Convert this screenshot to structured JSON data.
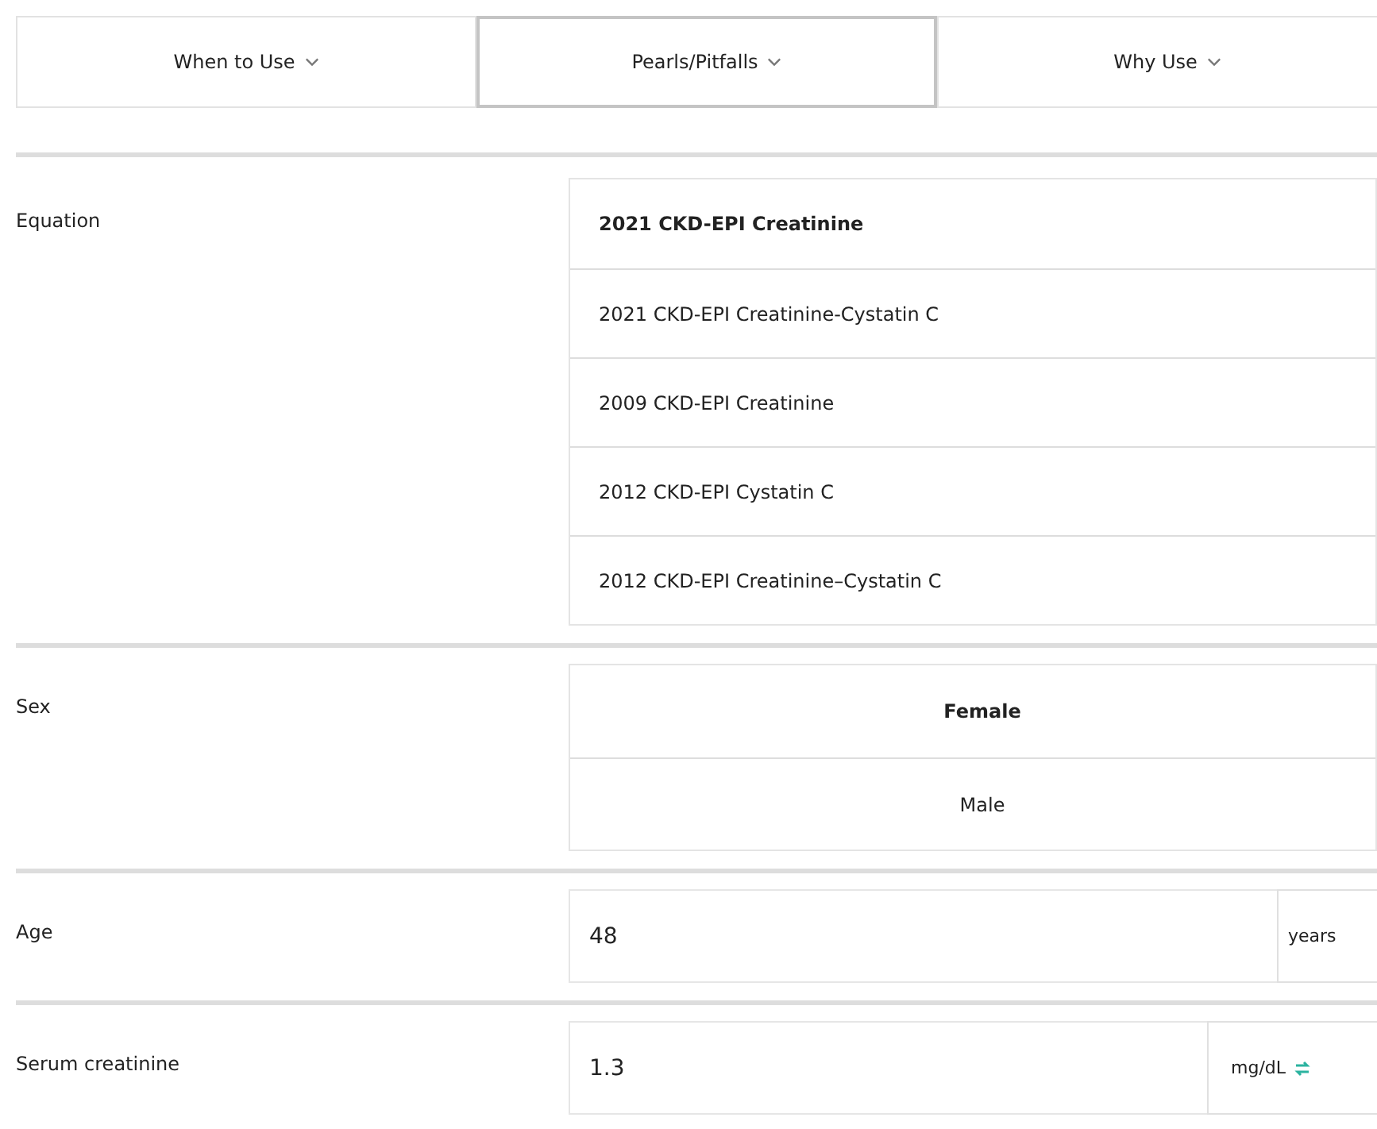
{
  "tabs": [
    {
      "label": "When to Use",
      "selected": false
    },
    {
      "label": "Pearls/Pitfalls",
      "selected": true
    },
    {
      "label": "Why Use",
      "selected": false
    }
  ],
  "fields": [
    {
      "kind": "list",
      "label": "Equation",
      "options": [
        {
          "label": "2021 CKD-EPI Creatinine",
          "selected": true
        },
        {
          "label": "2021 CKD-EPI Creatinine-Cystatin C",
          "selected": false
        },
        {
          "label": "2009 CKD-EPI Creatinine",
          "selected": false
        },
        {
          "label": "2012 CKD-EPI Cystatin C",
          "selected": false
        },
        {
          "label": "2012 CKD-EPI Creatinine–Cystatin C",
          "selected": false
        }
      ]
    },
    {
      "kind": "toggle",
      "label": "Sex",
      "options": [
        {
          "label": "Female",
          "selected": true
        },
        {
          "label": "Male",
          "selected": false
        }
      ]
    },
    {
      "kind": "input",
      "label": "Age",
      "value": "48",
      "unit": "years",
      "unit_switch": false
    },
    {
      "kind": "input",
      "label": "Serum creatinine",
      "value": "1.3",
      "unit": "mg/dL",
      "unit_switch": true
    }
  ]
}
